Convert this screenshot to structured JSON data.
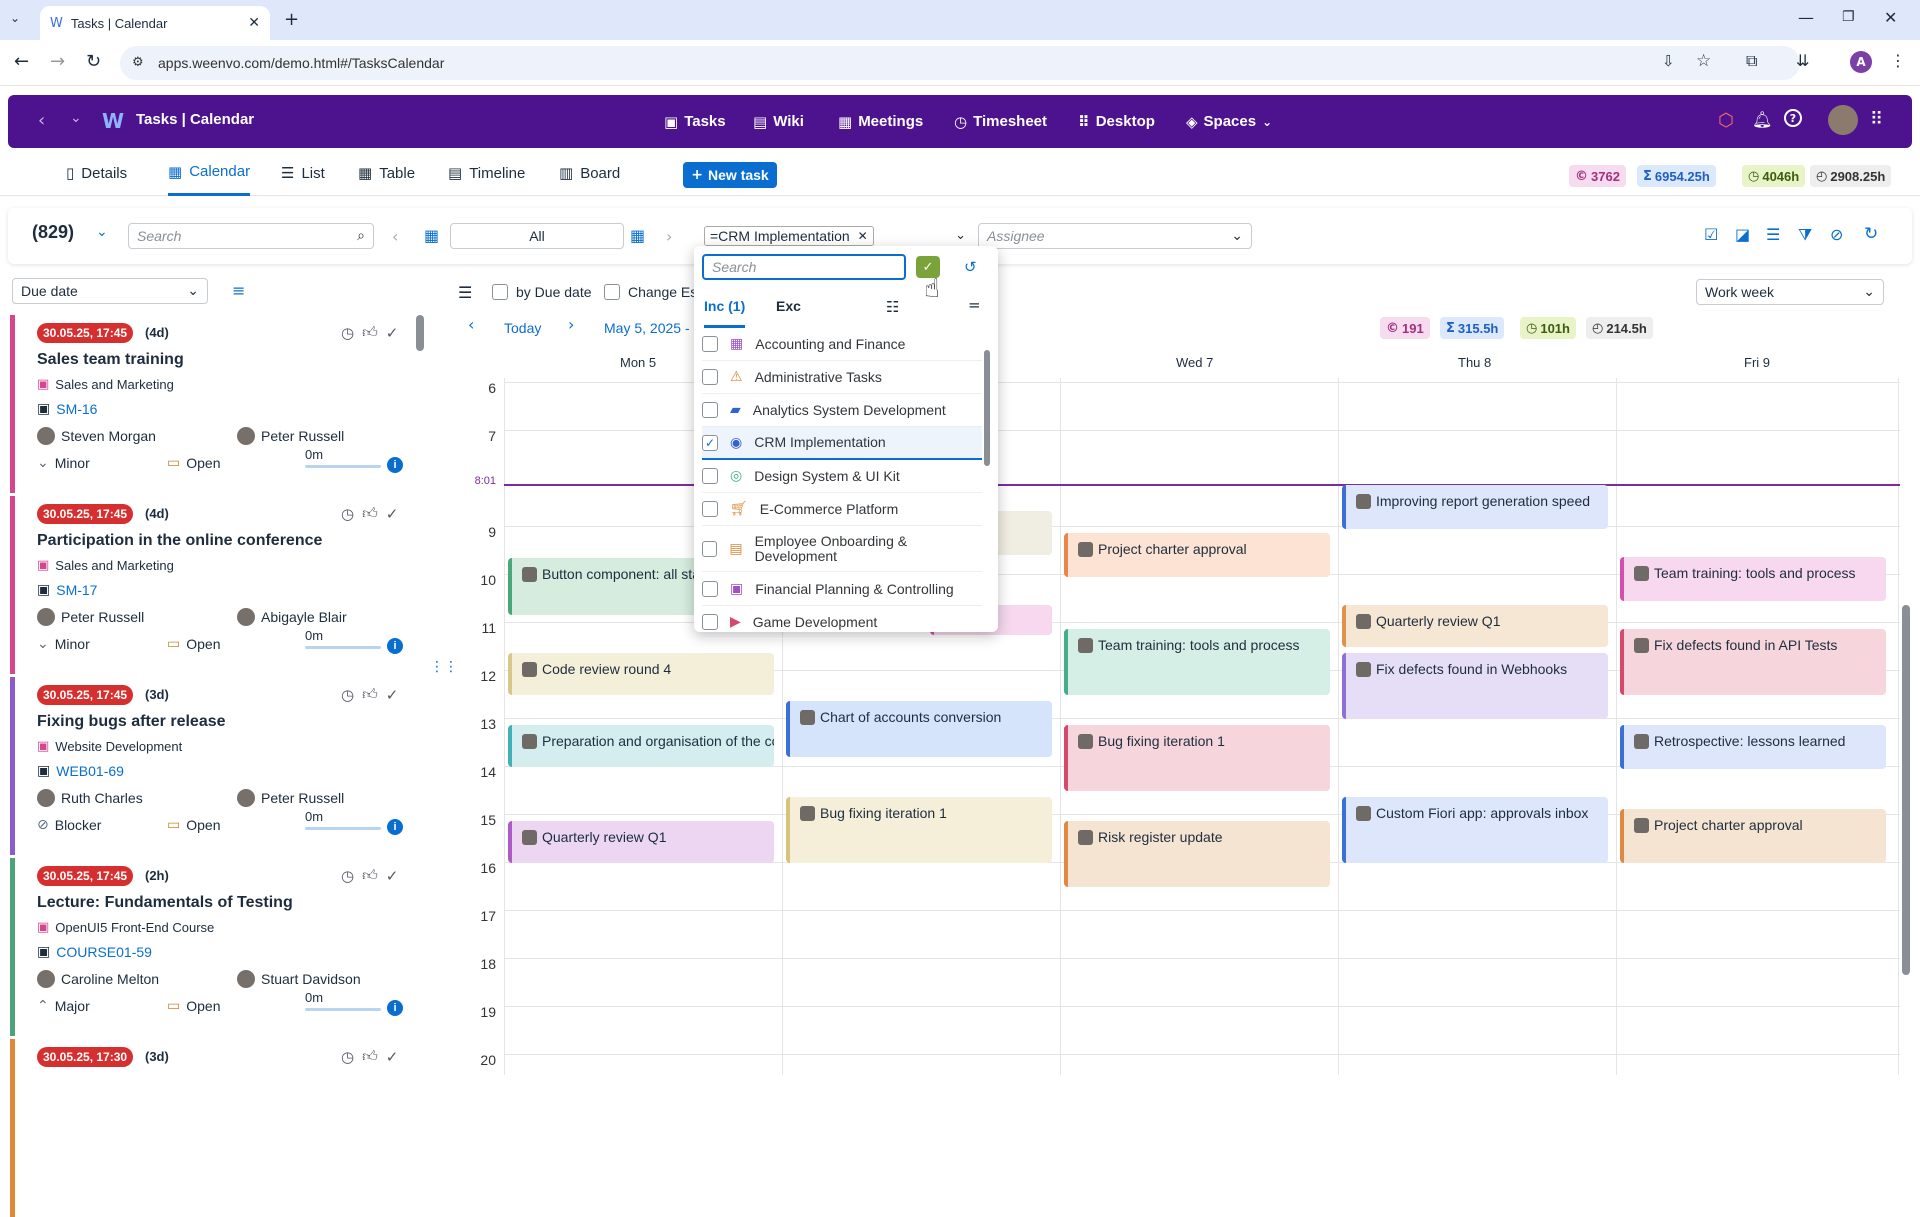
{
  "browser": {
    "tab_title": "Tasks | Calendar",
    "url": "apps.weenvo.com/demo.html#/TasksCalendar",
    "profile_initial": "A"
  },
  "app": {
    "title": "Tasks | Calendar",
    "nav": [
      "Tasks",
      "Wiki",
      "Meetings",
      "Timesheet",
      "Desktop",
      "Spaces"
    ]
  },
  "views": {
    "tabs": [
      "Details",
      "Calendar",
      "List",
      "Table",
      "Timeline",
      "Board"
    ],
    "active": "Calendar",
    "new_task": "New task",
    "stats": [
      "3762",
      "6954.25h",
      "4046h",
      "2908.25h"
    ]
  },
  "filters": {
    "count": "(829)",
    "search_placeholder": "Search",
    "period": "All",
    "project_filter": "=CRM Implementation",
    "assignee_placeholder": "Assignee",
    "sort": "Due date",
    "view_mode": "Work week",
    "by_due_date": "by Due date",
    "change_est": "Change Es"
  },
  "calendar_nav": {
    "today": "Today",
    "range": "May 5, 2025 -",
    "stats": [
      "191",
      "315.5h",
      "101h",
      "214.5h"
    ],
    "days": [
      "Mon 5",
      "Wed 7",
      "Thu 8",
      "Fri 9"
    ],
    "hours": [
      "6",
      "7",
      "8:01",
      "9",
      "10",
      "11",
      "12",
      "13",
      "14",
      "15",
      "16",
      "17",
      "18",
      "19",
      "20"
    ]
  },
  "tasks": [
    {
      "date": "30.05.25, 17:45",
      "dur": "(4d)",
      "title": "Sales team training",
      "project": "Sales and Marketing",
      "code": "SM-16",
      "owner": "Steven Morgan",
      "assignee": "Peter Russell",
      "priority": "Minor",
      "status": "Open",
      "time": "0m",
      "color": "#d5468f"
    },
    {
      "date": "30.05.25, 17:45",
      "dur": "(4d)",
      "title": "Participation in the online conference",
      "project": "Sales and Marketing",
      "code": "SM-17",
      "owner": "Peter Russell",
      "assignee": "Abigayle Blair",
      "priority": "Minor",
      "status": "Open",
      "time": "0m",
      "color": "#d5468f"
    },
    {
      "date": "30.05.25, 17:45",
      "dur": "(3d)",
      "title": "Fixing bugs after release",
      "project": "Website Development",
      "code": "WEB01-69",
      "owner": "Ruth Charles",
      "assignee": "Peter Russell",
      "priority": "Blocker",
      "status": "Open",
      "time": "0m",
      "color": "#8a5cd1"
    },
    {
      "date": "30.05.25, 17:45",
      "dur": "(2h)",
      "title": "Lecture: Fundamentals of Testing",
      "project": "OpenUI5 Front-End Course",
      "code": "COURSE01-59",
      "owner": "Caroline Melton",
      "assignee": "Stuart Davidson",
      "priority": "Major",
      "status": "Open",
      "time": "0m",
      "color": "#4ca37a"
    },
    {
      "date": "30.05.25, 17:30",
      "dur": "(3d)",
      "title": "",
      "project": "",
      "code": "",
      "owner": "",
      "assignee": "",
      "priority": "",
      "status": "",
      "time": "",
      "color": "#e0883a"
    }
  ],
  "events": [
    {
      "title": "Button component: all sta",
      "bg": "#d6ecdf",
      "border": "#4aa77a"
    },
    {
      "title": "Code review round 4",
      "bg": "#f4efd9",
      "border": "#d8c78c"
    },
    {
      "title": "Preparation and organisation of the cc",
      "bg": "#d4eef0",
      "border": "#42b0b8"
    },
    {
      "title": "Quarterly review Q1",
      "bg": "#ecd6f2",
      "border": "#b05ac9"
    },
    {
      "title": "Chart of accounts conversion",
      "bg": "#d6e4fb",
      "border": "#3c6fd6"
    },
    {
      "title": "Bug fixing iteration 1",
      "bg": "#f5efd9",
      "border": "#d6c27c"
    },
    {
      "title": "Project charter approval",
      "bg": "#fde3d3",
      "border": "#e8874c"
    },
    {
      "title": "Team training: tools and process",
      "bg": "#d6efe6",
      "border": "#45ad8a"
    },
    {
      "title": "Bug fixing iteration 1",
      "bg": "#f7d5dc",
      "border": "#d54a6a"
    },
    {
      "title": "Risk register update",
      "bg": "#f6e4d3",
      "border": "#de8a43"
    },
    {
      "title": "Improving report generation speed",
      "bg": "#dde6fb",
      "border": "#3c6fd6"
    },
    {
      "title": "Quarterly review Q1",
      "bg": "#f6e7d4",
      "border": "#e0924a"
    },
    {
      "title": "Fix defects found in Webhooks",
      "bg": "#e6def6",
      "border": "#8f6ed6"
    },
    {
      "title": "Custom Fiori app: approvals inbox",
      "bg": "#dde6fb",
      "border": "#3c6fd6"
    },
    {
      "title": "Team training: tools and process",
      "bg": "#f7d8ef",
      "border": "#d24fae"
    },
    {
      "title": "Fix defects found in API Tests",
      "bg": "#f7d5dc",
      "border": "#d54a6a"
    },
    {
      "title": "Retrospective: lessons learned",
      "bg": "#dde6fb",
      "border": "#3c6fd6"
    },
    {
      "title": "Project charter approval",
      "bg": "#f6e4d3",
      "border": "#de8a43"
    }
  ],
  "dropdown": {
    "search_placeholder": "Search",
    "inc_tab": "Inc (1)",
    "exc_tab": "Exc",
    "options": [
      {
        "label": "Accounting and Finance",
        "checked": false
      },
      {
        "label": "Administrative Tasks",
        "checked": false
      },
      {
        "label": "Analytics System Development",
        "checked": false
      },
      {
        "label": "CRM Implementation",
        "checked": true
      },
      {
        "label": "Design System & UI Kit",
        "checked": false
      },
      {
        "label": "E-Commerce Platform",
        "checked": false
      },
      {
        "label": "Employee Onboarding & Development",
        "checked": false
      },
      {
        "label": "Financial Planning & Controlling",
        "checked": false
      },
      {
        "label": "Game Development",
        "checked": false
      }
    ]
  },
  "colors": {
    "brand": "#4d138e",
    "accent": "#0a6ed1",
    "now_line": "#7b2c9e",
    "overdue": "#d62f2f"
  }
}
